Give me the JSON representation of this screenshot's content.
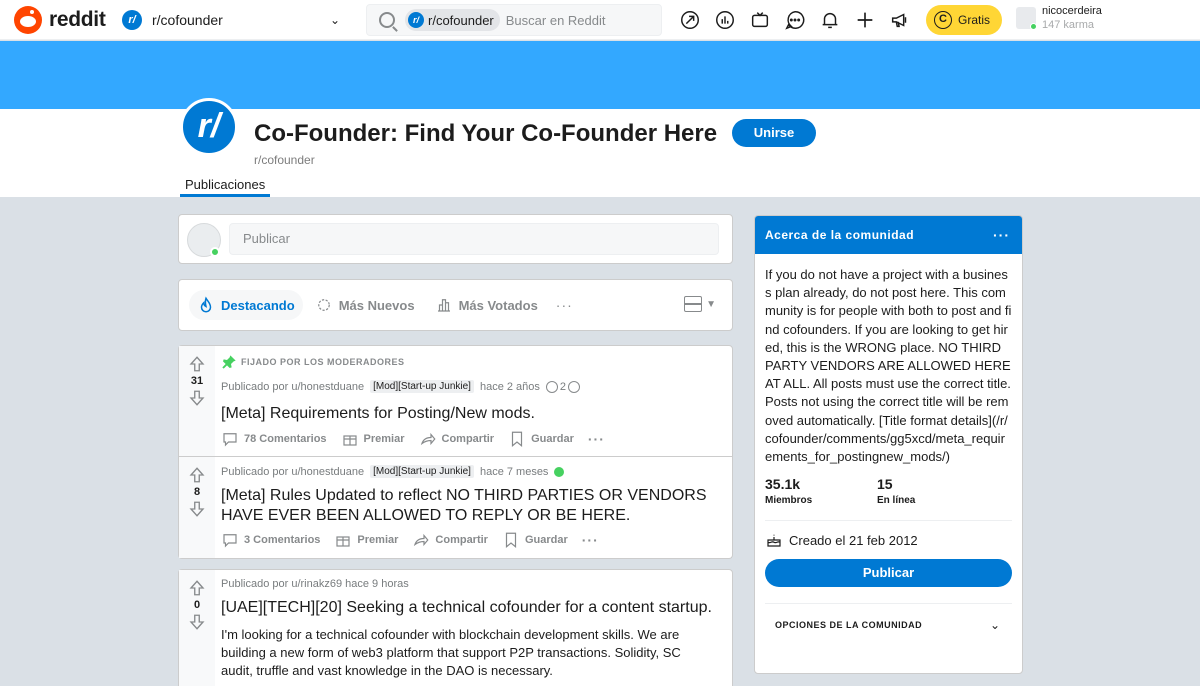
{
  "header": {
    "logo_text": "reddit",
    "community_dropdown_icon": "r/",
    "community_dropdown_label": "r/cofounder",
    "search_chip": "r/cofounder",
    "search_placeholder": "Buscar en Reddit",
    "icons": [
      "popular-icon",
      "stats-icon",
      "tv-icon",
      "chat-icon",
      "bell-icon",
      "plus-icon",
      "megaphone-icon"
    ],
    "coins_label": "Gratis",
    "coin_symbol": "C",
    "username": "nicocerdeira",
    "karma": "147 karma"
  },
  "subreddit": {
    "icon_text": "r/",
    "title": "Co-Founder: Find Your Co-Founder Here",
    "name": "r/cofounder",
    "join_label": "Unirse",
    "tab_label": "Publicaciones"
  },
  "create_post": {
    "placeholder": "Publicar"
  },
  "sort": {
    "hot": "Destacando",
    "new": "Más Nuevos",
    "top": "Más Votados",
    "more": "···"
  },
  "posts": [
    {
      "pinned_label": "FIJADO POR LOS MODERADORES",
      "votes": "31",
      "posted_by": "Publicado por u/honestduane",
      "flair": "[Mod][Start-up Junkie]",
      "time": "hace 2 años",
      "award_count": "2",
      "title": "[Meta] Requirements for Posting/New mods.",
      "comments": "78 Comentarios",
      "award": "Premiar",
      "share": "Compartir",
      "save": "Guardar"
    },
    {
      "votes": "8",
      "posted_by": "Publicado por u/honestduane",
      "flair": "[Mod][Start-up Junkie]",
      "time": "hace 7 meses",
      "title": "[Meta] Rules Updated to reflect NO THIRD PARTIES OR VENDORS HAVE EVER BEEN ALLOWED TO REPLY OR BE HERE.",
      "comments": "3 Comentarios",
      "award": "Premiar",
      "share": "Compartir",
      "save": "Guardar"
    },
    {
      "votes": "0",
      "posted_by": "Publicado por u/rinakz69 hace 9 horas",
      "title": "[UAE][TECH][20] Seeking a technical cofounder for a content startup.",
      "body": "I'm looking for a technical cofounder with blockchain development skills. We are building a new form of web3 platform that support P2P transactions. Solidity, SC audit, truffle and vast knowledge in the DAO is necessary."
    }
  ],
  "about": {
    "header": "Acerca de la comunidad",
    "more": "···",
    "description": "If you do not have a project with a business plan already, do not post here. This community is for people with both to post and find cofounders. If you are looking to get hired, this is the WRONG place. NO THIRD PARTY VENDORS ARE ALLOWED HERE AT ALL. All posts must use the correct title. Posts not using the correct title will be removed automatically. [Title format details](/r/cofounder/comments/gg5xcd/meta_requirements_for_postingnew_mods/)",
    "members_count": "35.1k",
    "members_label": "Miembros",
    "online_count": "15",
    "online_label": "En línea",
    "created": "Creado el 21 feb 2012",
    "publish_label": "Publicar",
    "options_label": "OPCIONES DE LA COMUNIDAD"
  },
  "colors": {
    "accent": "#0079d3",
    "banner": "#33a8ff",
    "reddit_orange": "#ff4500",
    "online_green": "#46d160",
    "coin_yellow": "#ffd635"
  }
}
